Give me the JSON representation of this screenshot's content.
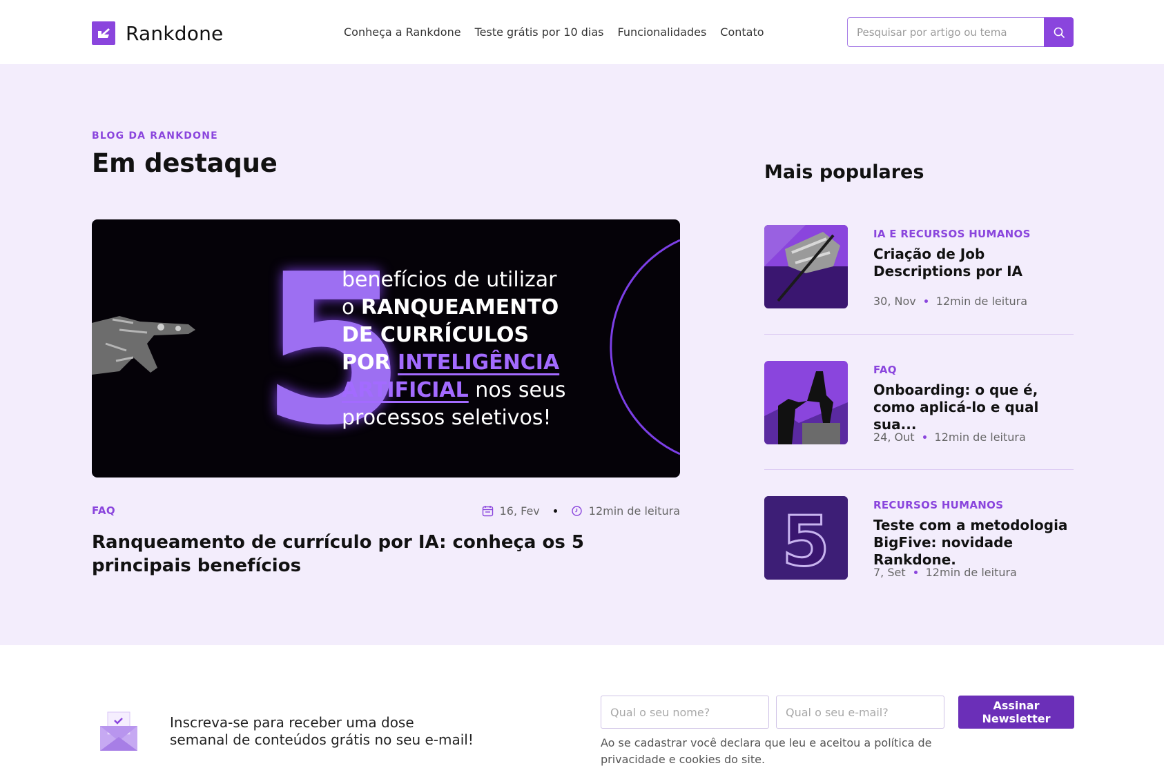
{
  "brand": {
    "name": "Rankdone",
    "accent": "#8a45dd"
  },
  "nav": {
    "items": [
      {
        "label": "Conheça a Rankdone"
      },
      {
        "label": "Teste grátis por 10 dias"
      },
      {
        "label": "Funcionalidades"
      },
      {
        "label": "Contato"
      }
    ]
  },
  "search": {
    "placeholder": "Pesquisar por artigo ou tema",
    "icon": "search-icon"
  },
  "hero": {
    "eyebrow": "BLOG DA RANKDONE",
    "heading": "Em destaque",
    "featured": {
      "banner": {
        "number": "5",
        "line1": "benefícios de utilizar",
        "line2_pre": "o ",
        "line2_bold": "RANQUEAMENTO",
        "line3_bold": "DE CURRÍCULOS",
        "line4_bold": "POR ",
        "line4_purple": "INTELIGÊNCIA",
        "line5_purple": "ARTIFICIAL",
        "line5_post": " nos seus",
        "line6": "processos seletivos!"
      },
      "category": "FAQ",
      "date": "16, Fev",
      "read_time": "12min de leitura",
      "title": "Ranqueamento de currículo por IA: conheça os 5 principais benefícios"
    }
  },
  "popular": {
    "heading": "Mais populares",
    "items": [
      {
        "category": "IA E RECURSOS HUMANOS",
        "title": "Criação de Job Descriptions por IA",
        "date": "30, Nov",
        "read_time": "12min de leitura"
      },
      {
        "category": "FAQ",
        "title": "Onboarding: o que é, como aplicá-lo e qual sua...",
        "date": "24, Out",
        "read_time": "12min de leitura"
      },
      {
        "category": "RECURSOS HUMANOS",
        "title": "Teste com a metodologia BigFive: novidade Rankdone.",
        "date": "7, Set",
        "read_time": "12min de leitura",
        "thumb_number": "5"
      }
    ]
  },
  "newsletter": {
    "text": "Inscreva-se para receber uma dose semanal de conteúdos grátis no seu e-mail!",
    "name_placeholder": "Qual o seu nome?",
    "email_placeholder": "Qual o seu e-mail?",
    "button_label": "Assinar Newsletter",
    "legal": "Ao se cadastrar você declara que leu e aceitou a política de privacidade e cookies do site."
  }
}
